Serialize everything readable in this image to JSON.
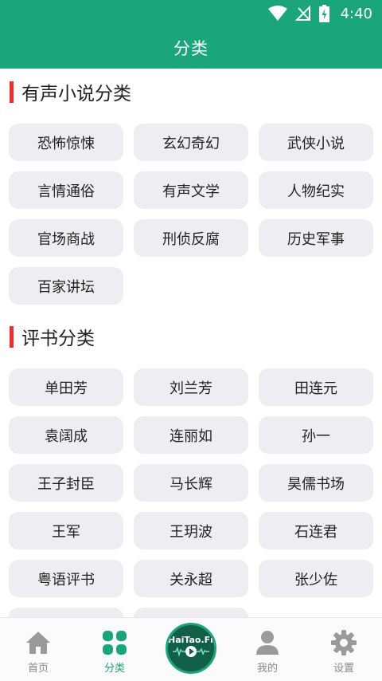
{
  "status_bar": {
    "time": "4:40"
  },
  "app_bar": {
    "title": "分类"
  },
  "sections": [
    {
      "title": "有声小说分类",
      "items": [
        "恐怖惊悚",
        "玄幻奇幻",
        "武侠小说",
        "言情通俗",
        "有声文学",
        "人物纪实",
        "官场商战",
        "刑侦反腐",
        "历史军事",
        "百家讲坛"
      ]
    },
    {
      "title": "评书分类",
      "items": [
        "单田芳",
        "刘兰芳",
        "田连元",
        "袁阔成",
        "连丽如",
        "孙一",
        "王子封臣",
        "马长辉",
        "昊儒书场",
        "王军",
        "王玥波",
        "石连君",
        "粤语评书",
        "关永超",
        "张少佐"
      ]
    }
  ],
  "bottom_nav": {
    "home_label": "首页",
    "category_label": "分类",
    "center_text": "HaiTao.Fm",
    "mine_label": "我的",
    "settings_label": "设置"
  },
  "colors": {
    "primary": "#1aa57a",
    "accent": "#e8312b",
    "chip_bg": "#eeeef2"
  }
}
